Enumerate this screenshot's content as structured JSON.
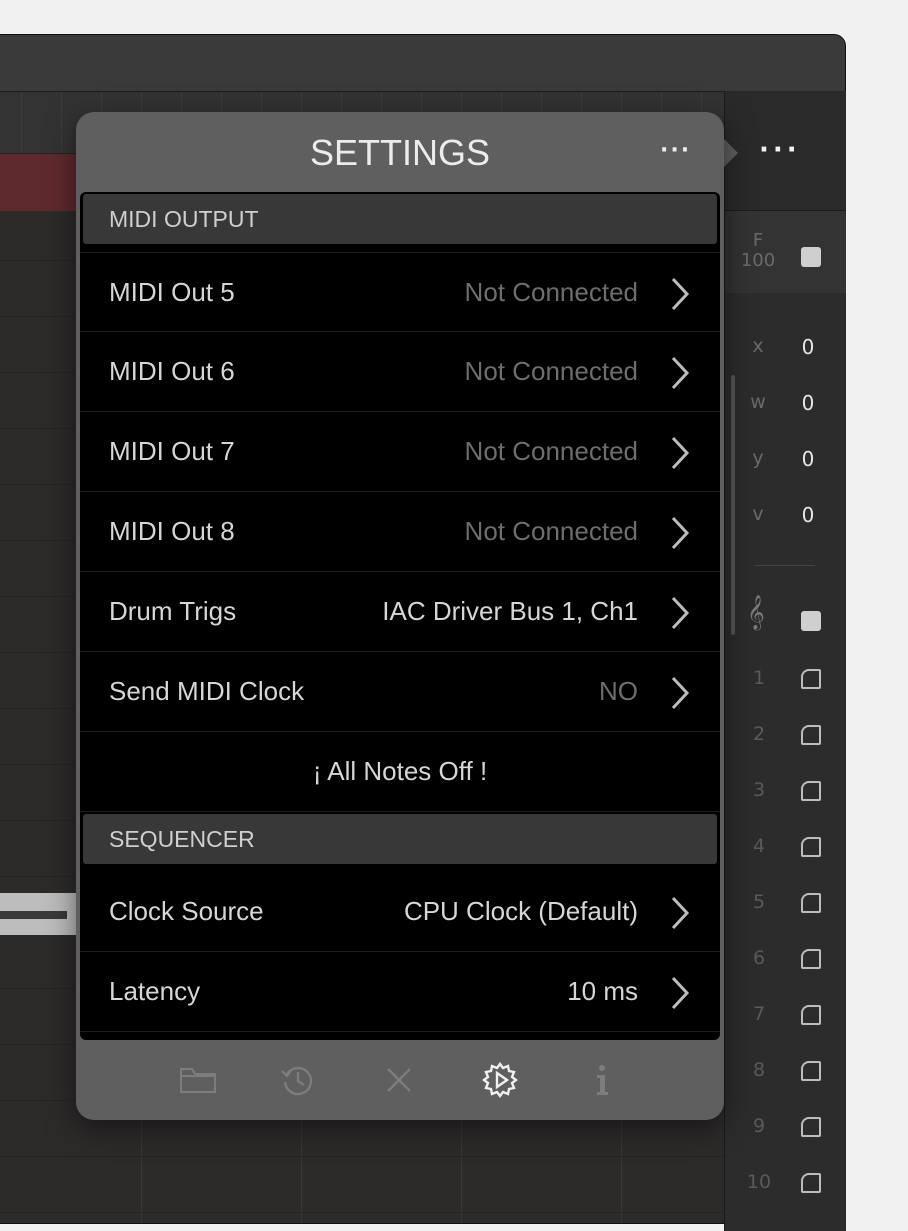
{
  "popover": {
    "title": "SETTINGS",
    "more": "···",
    "sections": {
      "midi_output": "MIDI OUTPUT",
      "sequencer": "SEQUENCER"
    },
    "rows": [
      {
        "label": "MIDI Out 5",
        "value": "Not Connected"
      },
      {
        "label": "MIDI Out 6",
        "value": "Not Connected"
      },
      {
        "label": "MIDI Out 7",
        "value": "Not Connected"
      },
      {
        "label": "MIDI Out 8",
        "value": "Not Connected"
      },
      {
        "label": "Drum Trigs",
        "value": "IAC Driver Bus 1, Ch1"
      },
      {
        "label": "Send MIDI Clock",
        "value": "NO"
      }
    ],
    "all_notes_off": "¡ All Notes Off !",
    "seq_rows": [
      {
        "label": "Clock Source",
        "value": "CPU Clock (Default)"
      },
      {
        "label": "Latency",
        "value": "10 ms"
      }
    ],
    "toolbar": [
      {
        "name": "folder-icon",
        "active": false
      },
      {
        "name": "history-icon",
        "active": false
      },
      {
        "name": "close-icon",
        "active": false
      },
      {
        "name": "settings-icon",
        "active": true
      },
      {
        "name": "info-icon",
        "active": false
      }
    ],
    "colors": {
      "active_icon": "#f0f0f0",
      "inactive_icon": "#7d7d7d"
    }
  },
  "right_panel": {
    "menu": "···",
    "f_label": "F",
    "f_value": "100",
    "params": [
      {
        "label": "x",
        "value": "0"
      },
      {
        "label": "w",
        "value": "0"
      },
      {
        "label": "y",
        "value": "0"
      },
      {
        "label": "v",
        "value": "0"
      }
    ],
    "clef": "𝄞",
    "tracks": [
      "1",
      "2",
      "3",
      "4",
      "5",
      "6",
      "7",
      "8",
      "9",
      "10"
    ]
  }
}
